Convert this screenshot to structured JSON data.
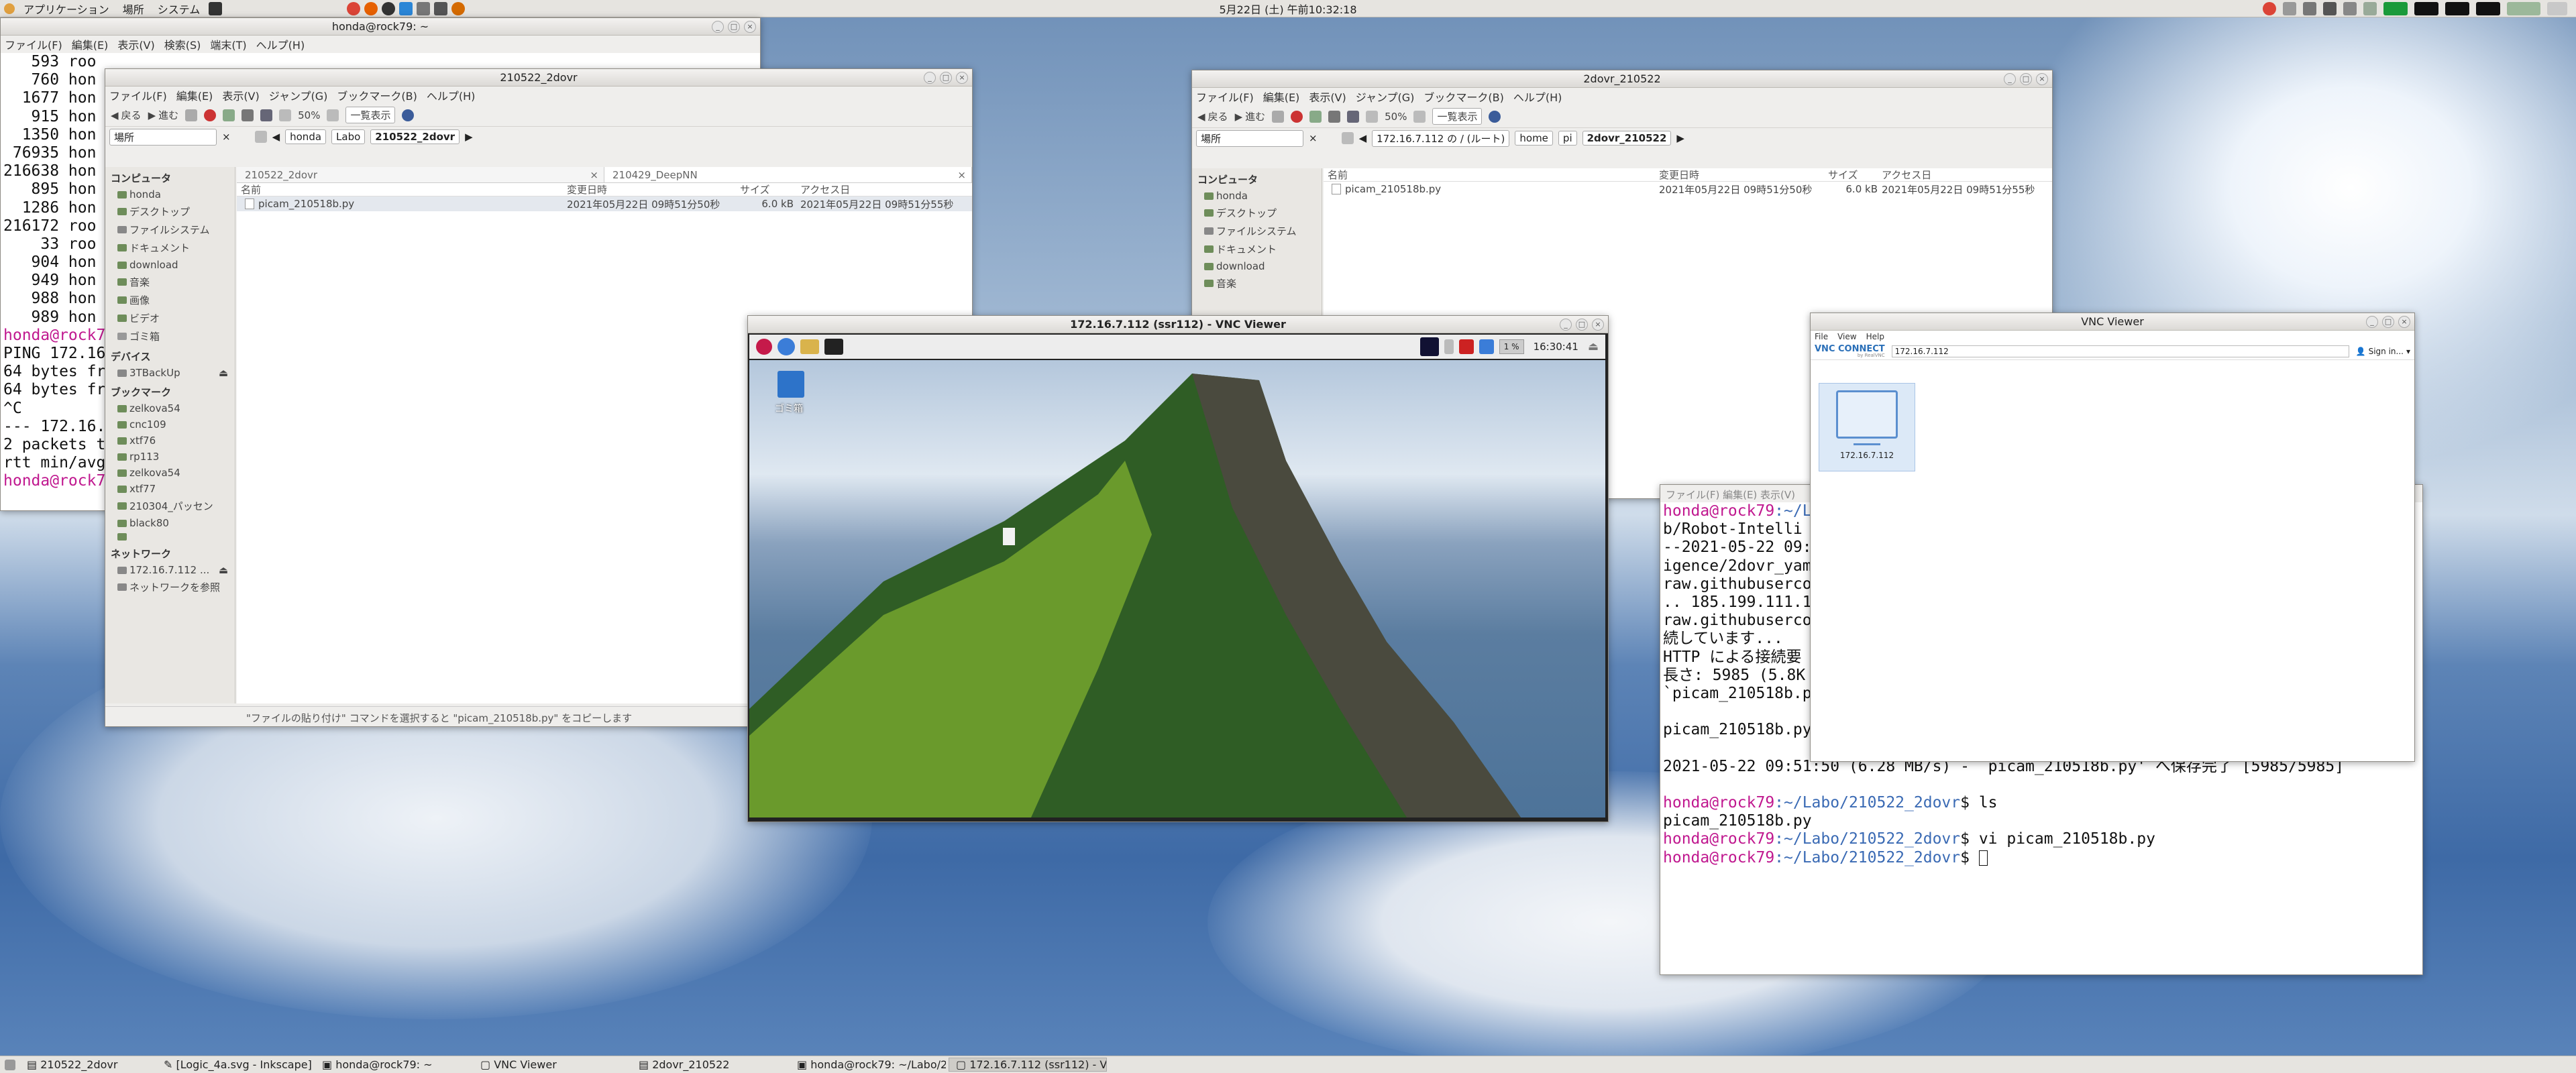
{
  "top_panel": {
    "menu_apps": "アプリケーション",
    "menu_places": "場所",
    "menu_system": "システム",
    "clock": "5月22日 (土) 午前10:32:18"
  },
  "terminal_left": {
    "title": "honda@rock79: ~",
    "menu": [
      "ファイル(F)",
      "編集(E)",
      "表示(V)",
      "検索(S)",
      "端末(T)",
      "ヘルプ(H)"
    ],
    "lines": [
      "   593 roo",
      "   760 hon",
      "  1677 hon",
      "   915 hon",
      "  1350 hon",
      " 76935 hon",
      "216638 hon",
      "   895 hon",
      "  1286 hon",
      "216172 roo",
      "    33 roo",
      "   904 hon",
      "   949 hon",
      "   988 hon",
      "   989 hon"
    ],
    "prompt_tail": "honda@rock79",
    "tail_lines": [
      "PING 172.16",
      "64 bytes fr",
      "64 bytes fr",
      "^C",
      "--- 172.16.",
      "2 packets t",
      "rtt min/avg"
    ],
    "last_prompt": "honda@rock79"
  },
  "fm_left": {
    "title": "210522_2dovr",
    "menu": [
      "ファイル(F)",
      "編集(E)",
      "表示(V)",
      "ジャンプ(G)",
      "ブックマーク(B)",
      "ヘルプ(H)"
    ],
    "toolbar": {
      "back": "戻る",
      "forward": "進む",
      "zoom": "50%",
      "view": "一覧表示"
    },
    "places_label": "場所",
    "path": [
      "honda",
      "Labo",
      "210522_2dovr"
    ],
    "tabs": [
      "210522_2dovr",
      "210429_DeepNN"
    ],
    "columns": [
      "名前",
      "変更日時",
      "サイズ",
      "アクセス日"
    ],
    "files": [
      {
        "name": "picam_210518b.py",
        "modified": "2021年05月22日 09時51分50秒",
        "size": "6.0 kB",
        "accessed": "2021年05月22日 09時51分55秒"
      }
    ],
    "sidebar": {
      "computer": "コンピュータ",
      "computer_items": [
        "honda",
        "デスクトップ",
        "ファイルシステム",
        "ドキュメント",
        "download",
        "音楽",
        "画像",
        "ビデオ",
        "ゴミ箱"
      ],
      "devices": "デバイス",
      "device_items": [
        "3TBackUp"
      ],
      "bookmarks": "ブックマーク",
      "bookmark_items": [
        "zelkova54",
        "cnc109",
        "xtf76",
        "rp113",
        "zelkova54",
        "xtf77",
        "210304_パッセン",
        "black80",
        ""
      ],
      "network": "ネットワーク",
      "network_items": [
        "172.16.7.112 ...",
        "ネットワークを参照"
      ]
    },
    "status": "\"ファイルの貼り付け\" コマンドを選択すると \"picam_210518b.py\" をコピーします"
  },
  "fm_right": {
    "title": "2dovr_210522",
    "menu": [
      "ファイル(F)",
      "編集(E)",
      "表示(V)",
      "ジャンプ(G)",
      "ブックマーク(B)",
      "ヘルプ(H)"
    ],
    "toolbar": {
      "back": "戻る",
      "forward": "進む",
      "zoom": "50%",
      "view": "一覧表示"
    },
    "places_label": "場所",
    "path": [
      "172.16.7.112 の / (ルート)",
      "home",
      "pi",
      "2dovr_210522"
    ],
    "columns": [
      "名前",
      "変更日時",
      "サイズ",
      "アクセス日"
    ],
    "files": [
      {
        "name": "picam_210518b.py",
        "modified": "2021年05月22日 09時51分50秒",
        "size": "6.0 kB",
        "accessed": "2021年05月22日 09時51分55秒"
      }
    ],
    "sidebar": {
      "computer": "コンピュータ",
      "computer_items": [
        "honda",
        "デスクトップ",
        "ファイルシステム",
        "ドキュメント",
        "download",
        "音楽"
      ]
    }
  },
  "vnc_window": {
    "title": "172.16.7.112 (ssr112) - VNC Viewer",
    "cpu": "1 %",
    "time": "16:30:41",
    "trash_label": "ゴミ箱"
  },
  "vnc_viewer": {
    "title": "VNC Viewer",
    "menu": [
      "File",
      "View",
      "Help"
    ],
    "logo": "VNC CONNECT",
    "logo_sub": "by RealVNC",
    "address": "172.16.7.112",
    "signin": "Sign in...",
    "host_label": "172.16.7.112"
  },
  "terminal_right": {
    "menu_partial": "ファイル(F)  編集(E)  表示(V)",
    "lines_partial": [
      "b/Robot-Intelli",
      "--2021-05-22 09:",
      "igence/2dovr_yam",
      "raw.githubuserco",
      ".. 185.199.111.1",
      "raw.githubuserco",
      "続しています...",
      "HTTP による接続要",
      "長さ: 5985 (5.8K",
      "`picam_210518b.p"
    ],
    "progress_line": "picam_210518b.py",
    "saved_line": "2021-05-22 09:51:50 (6.28 MB/s) - `picam_210518b.py' へ保存完了 [5985/5985]",
    "prompt_user": "honda@rock79",
    "prompt_path": ":~/Labo/210522_2dovr",
    "prompt_partial_path": ":~/Lab",
    "cmd1": "$ ls",
    "out1": "picam_210518b.py",
    "cmd2": "$ vi picam_210518b.py",
    "cmd3": "$ "
  },
  "taskbar": [
    "210522_2dovr",
    "[Logic_4a.svg - Inkscape]",
    "honda@rock79: ~",
    "VNC Viewer",
    "2dovr_210522",
    "honda@rock79: ~/Labo/2...",
    "172.16.7.112 (ssr112) - V..."
  ]
}
